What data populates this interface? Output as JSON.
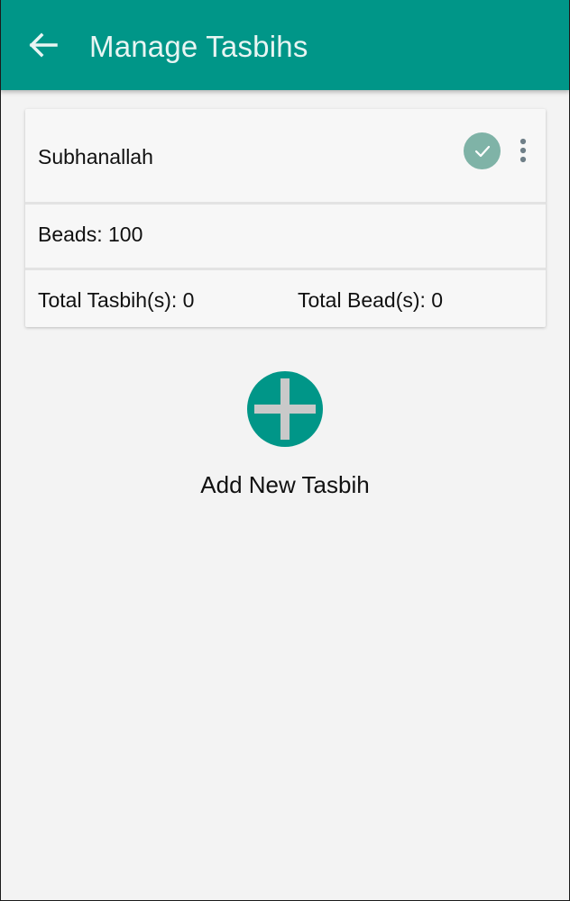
{
  "appbar": {
    "title": "Manage Tasbihs",
    "back_icon": "arrow-left-icon",
    "color": "#009688"
  },
  "tasbih_card": {
    "name": "Subhanallah",
    "beads_text": "Beads: 100",
    "total_tasbih_text": "Total Tasbih(s): 0",
    "total_beads_text": "Total Bead(s): 0",
    "selected_icon": "check-circle-icon",
    "menu_icon": "more-vertical-icon"
  },
  "add_tasbih": {
    "label": "Add New Tasbih",
    "icon": "plus-circle-icon"
  },
  "colors": {
    "accent": "#009688",
    "check_circle": "#7fb3a7",
    "background": "#f3f3f3"
  }
}
